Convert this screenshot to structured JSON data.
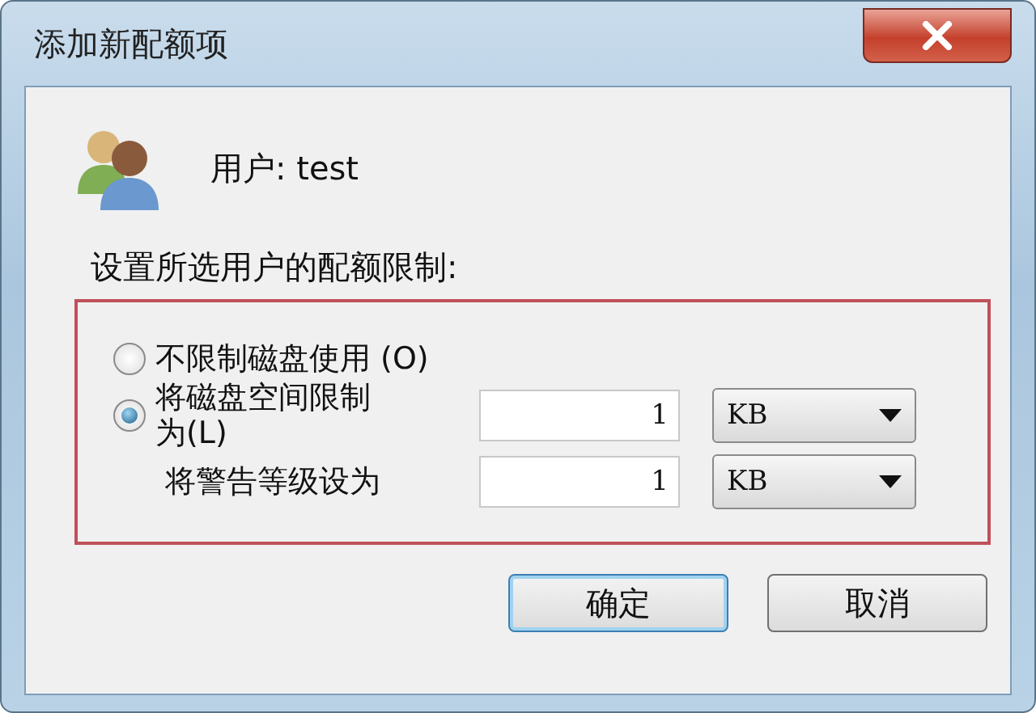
{
  "window": {
    "title": "添加新配额项"
  },
  "user": {
    "label": "用户: test"
  },
  "quota_label": "设置所选用户的配额限制:",
  "options": [
    {
      "kind": "radio",
      "label": "不限制磁盘使用 (O)",
      "selected": false
    },
    {
      "kind": "radio",
      "label": "将磁盘空间限制为(L)",
      "selected": true,
      "value": "1",
      "unit": "KB"
    },
    {
      "kind": "setting",
      "label": "将警告等级设为",
      "value": "1",
      "unit": "KB"
    }
  ],
  "buttons": [
    {
      "label": "确定",
      "default": true
    },
    {
      "label": "取消",
      "default": false
    }
  ]
}
